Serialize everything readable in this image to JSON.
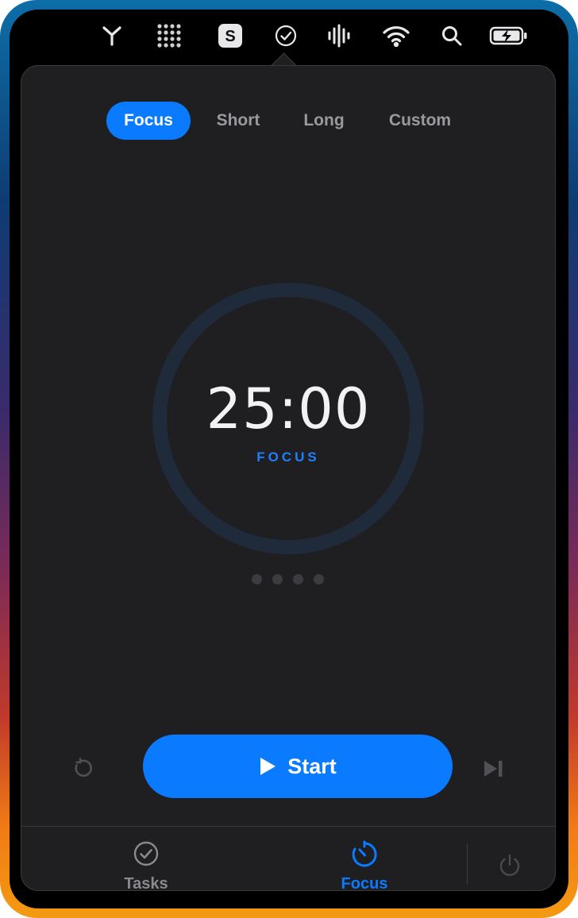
{
  "menubar": {
    "icons": [
      "y-icon",
      "grid-dots-icon",
      "s-app-icon",
      "checkmark-circle-icon",
      "waveform-icon",
      "wifi-icon",
      "search-icon",
      "battery-charging-icon"
    ]
  },
  "tabs": [
    {
      "label": "Focus",
      "active": true
    },
    {
      "label": "Short",
      "active": false
    },
    {
      "label": "Long",
      "active": false
    },
    {
      "label": "Custom",
      "active": false
    }
  ],
  "timer": {
    "time": "25:00",
    "mode": "FOCUS",
    "progress": 0,
    "sessions_total": 4,
    "sessions_completed": 0
  },
  "controls": {
    "start_label": "Start",
    "reset_icon": "reset-icon",
    "skip_icon": "skip-icon"
  },
  "bottom_nav": {
    "tasks_label": "Tasks",
    "focus_label": "Focus",
    "active": "Focus",
    "power_icon": "power-icon"
  },
  "colors": {
    "accent": "#0a7bff",
    "panel": "#1f1f21",
    "ring_track": "#1f2a3a",
    "inactive_text": "#9a9a9e"
  }
}
